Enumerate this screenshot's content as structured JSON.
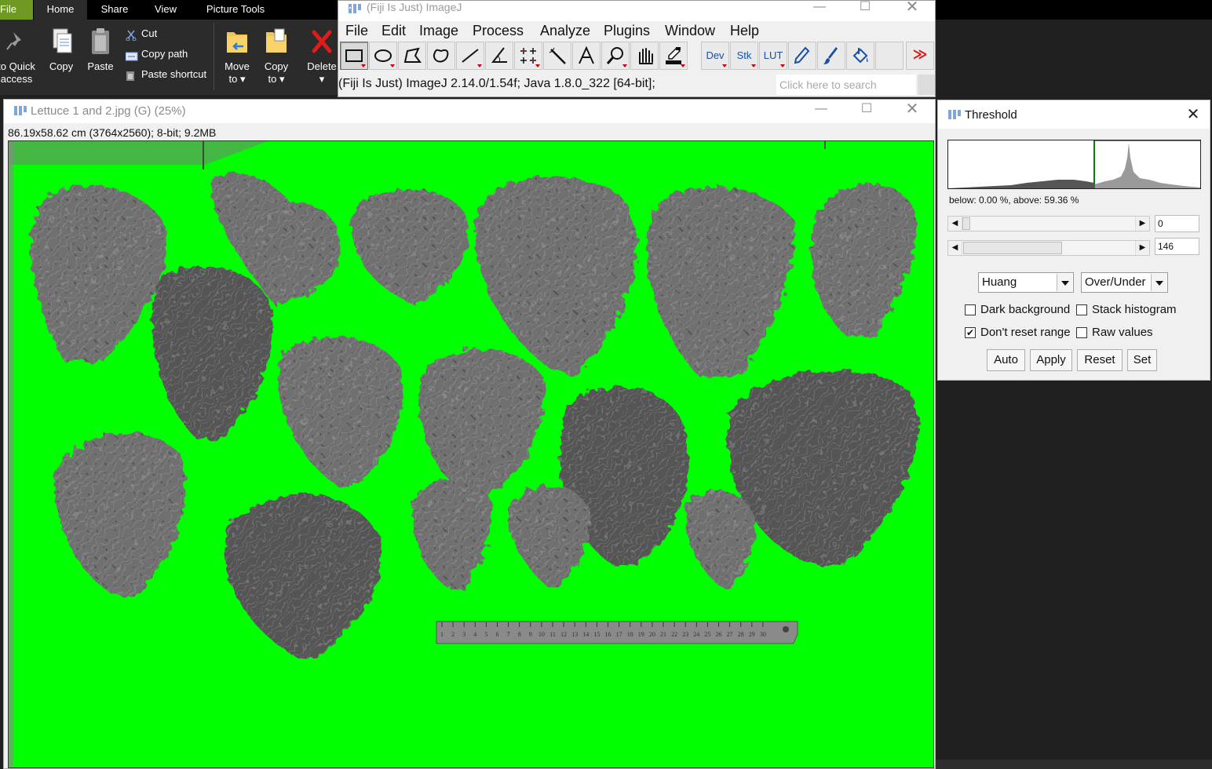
{
  "explorer": {
    "tabs": [
      "File",
      "Home",
      "Share",
      "View",
      "Picture Tools"
    ],
    "pin_label_line1": "to Quick",
    "pin_label_line2": "access",
    "copy_label": "Copy",
    "paste_label": "Paste",
    "cut_label": "Cut",
    "copy_path_label": "Copy path",
    "paste_shortcut_label": "Paste shortcut",
    "move_to_label": "Move",
    "move_to_label2": "to ▾",
    "copy_to_label": "Copy",
    "copy_to_label2": "to ▾",
    "delete_label": "Delete",
    "delete_label2": "▾",
    "colors": {
      "file_tab": "#6f9a21",
      "ribbon_bg": "#2b2b2b"
    }
  },
  "imagej": {
    "title": "(Fiji Is Just) ImageJ",
    "menus": [
      "File",
      "Edit",
      "Image",
      "Process",
      "Analyze",
      "Plugins",
      "Window",
      "Help"
    ],
    "tools": [
      "rectangle-tool",
      "oval-tool",
      "polygon-tool",
      "freehand-tool",
      "line-tool",
      "angle-tool",
      "multipoint-tool",
      "wand-tool",
      "text-tool",
      "magnifier-tool",
      "hand-tool",
      "color-picker-tool",
      "Dev",
      "Stk",
      "LUT",
      "pencil-tool",
      "brush-tool",
      "flood-fill-tool",
      "blank-tool",
      "more-tools"
    ],
    "dev_label": "Dev",
    "stk_label": "Stk",
    "lut_label": "LUT",
    "more_label": "≫",
    "status": "(Fiji Is Just) ImageJ 2.14.0/1.54f; Java 1.8.0_322 [64-bit];",
    "search_placeholder": "Click here to search"
  },
  "image_window": {
    "title": "Lettuce 1 and 2.jpg (G) (25%)",
    "info": "86.19x58.62 cm (3764x2560); 8-bit; 9.2MB",
    "overlay_color": "#00ff00"
  },
  "threshold": {
    "title": "Threshold",
    "stats": "below: 0.00 %,  above: 59.36 %",
    "min_value": "0",
    "max_value": "146",
    "method": "Huang",
    "display": "Over/Under",
    "checkboxes": {
      "dark_background": {
        "label": "Dark background",
        "checked": false
      },
      "stack_histogram": {
        "label": "Stack histogram",
        "checked": false
      },
      "dont_reset_range": {
        "label": "Don't reset range",
        "checked": true
      },
      "raw_values": {
        "label": "Raw values",
        "checked": false
      }
    },
    "buttons": {
      "auto": "Auto",
      "apply": "Apply",
      "reset": "Reset",
      "set": "Set"
    },
    "check_glyph": "✔",
    "min_fraction": 0.0,
    "max_fraction": 0.573
  },
  "ruler": {
    "ticks": [
      "1",
      "2",
      "3",
      "4",
      "5",
      "6",
      "7",
      "8",
      "9",
      "10",
      "11",
      "12",
      "13",
      "14",
      "15",
      "16",
      "17",
      "18",
      "19",
      "20",
      "21",
      "22",
      "23",
      "24",
      "25",
      "26",
      "27",
      "28",
      "29",
      "30"
    ]
  }
}
